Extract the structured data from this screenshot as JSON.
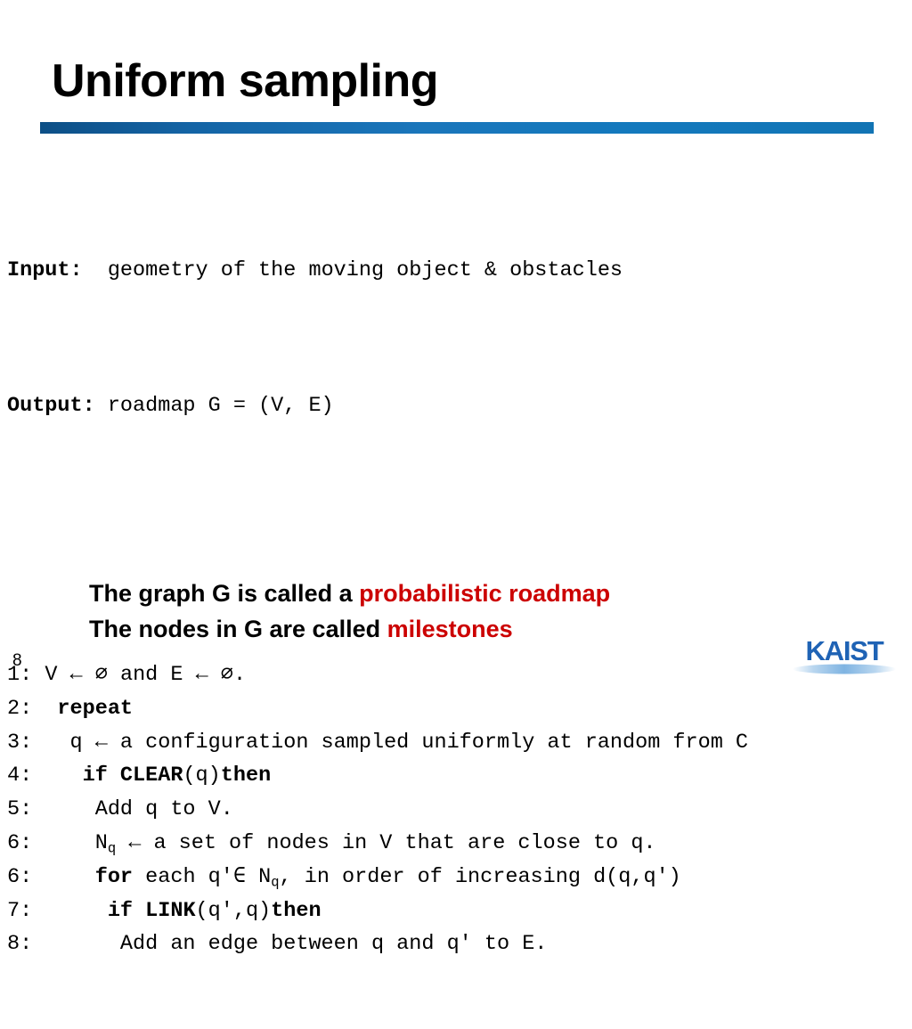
{
  "slide": {
    "title": "Uniform sampling",
    "number": "8",
    "accent_bar_color": "#1a76bb",
    "highlight_color": "#CC0000",
    "background_color": "#ffffff"
  },
  "header": {
    "input_label": "Input:",
    "input_value": "  geometry of the moving object & obstacles",
    "output_label": "Output:",
    "output_value": " roadmap G = (V, E)"
  },
  "algorithm": {
    "lines": [
      {
        "number": "1:",
        "indent": " ",
        "segments": [
          {
            "text": "V ← ∅ and E ← ∅.",
            "bold": false
          }
        ]
      },
      {
        "number": "2:",
        "indent": "  ",
        "segments": [
          {
            "text": "repeat",
            "bold": true
          }
        ]
      },
      {
        "number": "3:",
        "indent": "   ",
        "segments": [
          {
            "text": "q ← a configuration sampled uniformly at random from C",
            "bold": false
          }
        ]
      },
      {
        "number": "4:",
        "indent": "    ",
        "segments": [
          {
            "text": "if CLEAR",
            "bold": true
          },
          {
            "text": "(q)",
            "bold": false
          },
          {
            "text": "then",
            "bold": true
          }
        ]
      },
      {
        "number": "5:",
        "indent": "     ",
        "segments": [
          {
            "text": "Add q to V.",
            "bold": false
          }
        ]
      },
      {
        "number": "6:",
        "indent": "     ",
        "segments": [
          {
            "text": "N",
            "bold": false
          },
          {
            "text": "q",
            "bold": false,
            "sub": true
          },
          {
            "text": " ← a set of nodes in V that are close to q.",
            "bold": false
          }
        ]
      },
      {
        "number": "6:",
        "indent": "     ",
        "segments": [
          {
            "text": "for",
            "bold": true
          },
          {
            "text": " each q′∈ N",
            "bold": false
          },
          {
            "text": "q",
            "bold": false,
            "sub": true
          },
          {
            "text": ", in order of increasing d(q,q′)",
            "bold": false
          }
        ]
      },
      {
        "number": "7:",
        "indent": "      ",
        "segments": [
          {
            "text": "if LINK",
            "bold": true
          },
          {
            "text": "(q′,q)",
            "bold": false
          },
          {
            "text": "then",
            "bold": true
          }
        ]
      },
      {
        "number": "8:",
        "indent": "       ",
        "segments": [
          {
            "text": "Add an edge between q and q′ to E.",
            "bold": false
          }
        ]
      }
    ]
  },
  "statement": {
    "line1_prefix": "The graph G is called a ",
    "line1_highlight": "probabilistic roadmap",
    "line2_prefix": "The nodes in G are called ",
    "line2_highlight": "milestones"
  },
  "logo": {
    "name": "KAIST",
    "color": "#1f63b5"
  }
}
